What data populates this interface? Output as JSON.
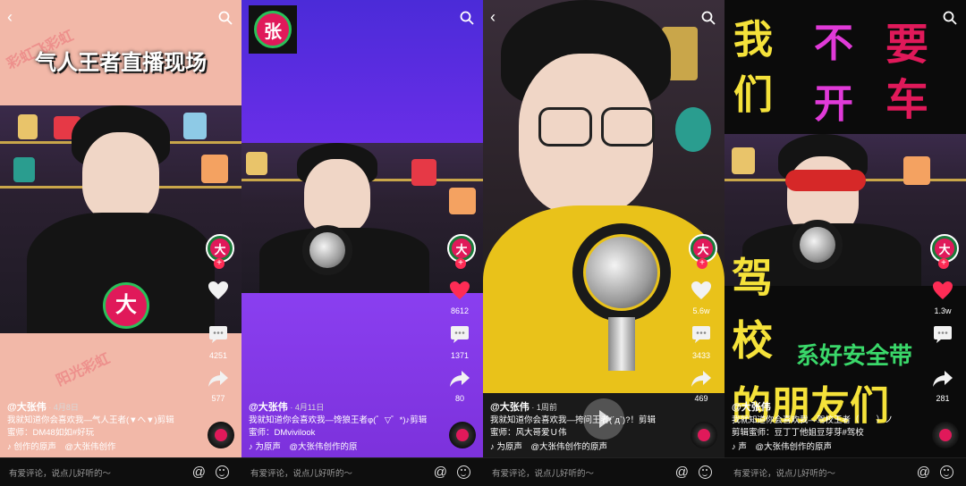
{
  "common": {
    "comment_placeholder": "有爱评论，说点儿好听的～",
    "at_symbol": "@"
  },
  "panels": [
    {
      "banner": "气人王者直播现场",
      "watermark_1": "彩虹飞彩虹",
      "watermark_2": "阳光彩虹",
      "user": "@大张伟",
      "date": "· 4月8日",
      "desc": "我就知道你会喜欢我—气人王者(▼へ▼)剪辑",
      "editor": "蜜师：DM48如如#好玩",
      "music": "♪ 创作的原声　@大张伟创作",
      "likes": "",
      "comments": "4251",
      "shares": "577"
    },
    {
      "user": "@大张伟",
      "date": "· 4月11日",
      "desc": "我就知道你会喜欢我—馋狼王者φ(゜▽゜*)♪剪辑",
      "editor": "蜜师：DMvivilook",
      "music": "♪ 为原声　@大张伟创作的原",
      "likes": "8612",
      "comments": "1371",
      "shares": "80"
    },
    {
      "user": "@大张伟",
      "date": "· 1周前",
      "desc": "我就知道你会喜欢我—挎问王者(´д`)?！剪辑",
      "editor": "蜜师：风大哥爱Ｕ伟",
      "music": "♪ 为原声　@大张伟创作的原声",
      "likes": "5.6w",
      "comments": "3433",
      "shares": "469"
    },
    {
      "text_top_1": "我",
      "text_top_2": "不",
      "text_top_3": "要",
      "text_top_4": "们",
      "text_top_5": "开",
      "text_top_6": "车",
      "text_mid_1": "驾",
      "text_mid_2": "校",
      "text_mid_3": "系好安全带",
      "text_bot": "的朋友们",
      "user": "@大张伟",
      "date": "",
      "desc": "我就知道你会喜欢我—驾校王者（　　）ノ",
      "editor": "剪辑蜜师：豆丁丁他姐豆芽芽#驾校",
      "music": "♪ 声　@大张伟创作的原声",
      "likes": "1.3w",
      "comments": "",
      "shares": "281"
    }
  ]
}
